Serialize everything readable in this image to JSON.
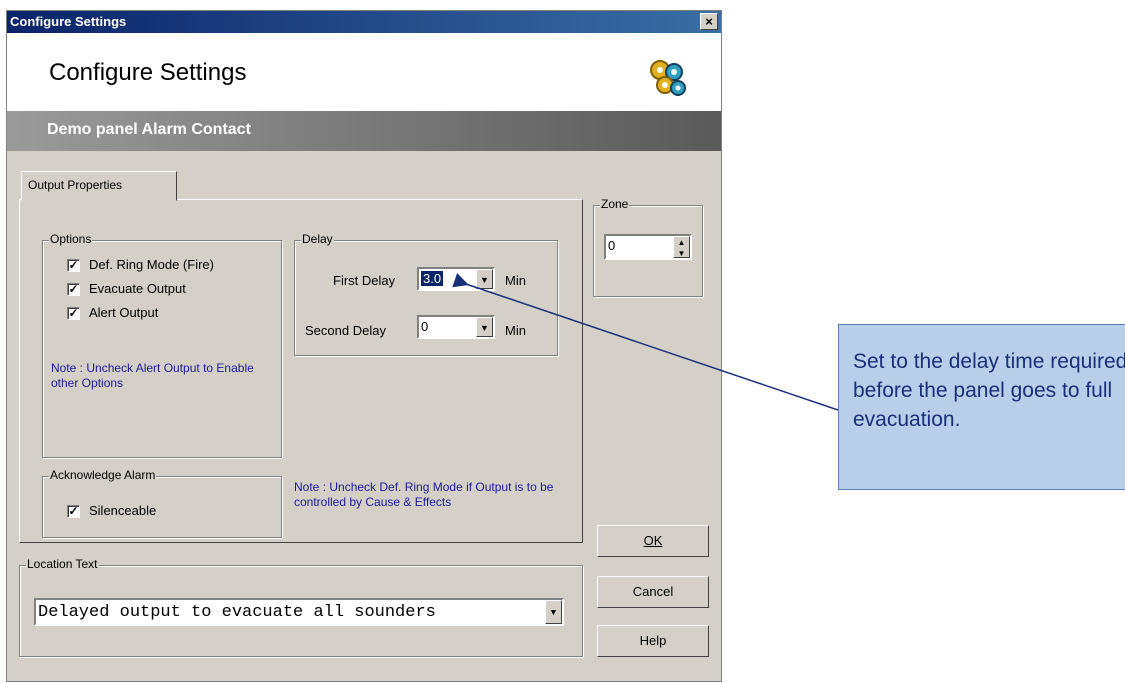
{
  "window": {
    "title": "Configure Settings",
    "close_label": "×"
  },
  "header": {
    "title": "Configure Settings",
    "icon": "gears-icon"
  },
  "subheader": {
    "text": "Demo panel Alarm Contact"
  },
  "tabs": [
    {
      "label": "Output Properties"
    }
  ],
  "options": {
    "label": "Options",
    "items": [
      {
        "label": "Def. Ring Mode (Fire)",
        "checked": true
      },
      {
        "label": "Evacuate Output",
        "checked": true
      },
      {
        "label": "Alert Output",
        "checked": true
      }
    ],
    "note": "Note : Uncheck Alert Output to Enable other Options"
  },
  "delay": {
    "label": "Delay",
    "first_label": "First Delay",
    "first_value": "3.0",
    "second_label": "Second Delay",
    "second_value": "0",
    "unit": "Min"
  },
  "acknowledge": {
    "label": "Acknowledge Alarm",
    "item": {
      "label": "Silenceable",
      "checked": true
    }
  },
  "ring_note": "Note : Uncheck Def. Ring Mode if Output is to be controlled by Cause & Effects",
  "zone": {
    "label": "Zone",
    "value": "0"
  },
  "location": {
    "label": "Location Text",
    "value": "Delayed output to evacuate all sounders"
  },
  "buttons": {
    "ok_label": "OK",
    "cancel_label": "Cancel",
    "help_label": "Help"
  },
  "callout": {
    "text": "Set to the delay time required before the panel goes to full evacuation."
  },
  "colors": {
    "titlebar": "#0a246a",
    "accent_text": "#1a1a9a",
    "callout_bg": "#b7cfe9"
  }
}
